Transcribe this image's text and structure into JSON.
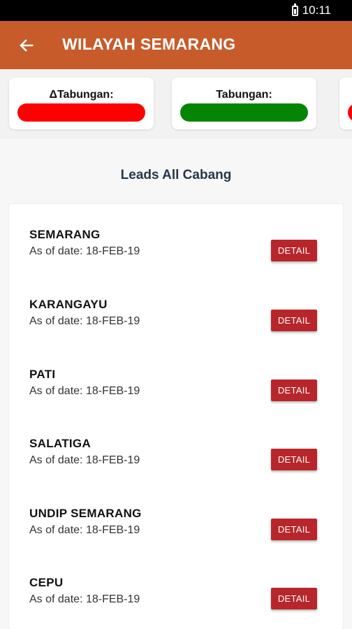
{
  "status_bar": {
    "time": "10:11"
  },
  "header": {
    "title": "WILAYAH SEMARANG"
  },
  "stat_cards": [
    {
      "label": "ΔTabungan:",
      "bar_color": "#ff0000"
    },
    {
      "label": "Tabungan:",
      "bar_color": "#048504"
    },
    {
      "label": "",
      "bar_color": "#ff0000"
    }
  ],
  "section": {
    "title": "Leads All Cabang"
  },
  "branches": [
    {
      "name": "SEMARANG",
      "date": "As of date: 18-FEB-19",
      "button": "DETAIL"
    },
    {
      "name": "KARANGAYU",
      "date": "As of date: 18-FEB-19",
      "button": "DETAIL"
    },
    {
      "name": "PATI",
      "date": "As of date: 18-FEB-19",
      "button": "DETAIL"
    },
    {
      "name": "SALATIGA",
      "date": "As of date: 18-FEB-19",
      "button": "DETAIL"
    },
    {
      "name": "UNDIP SEMARANG",
      "date": "As of date: 18-FEB-19",
      "button": "DETAIL"
    },
    {
      "name": "CEPU",
      "date": "As of date: 18-FEB-19",
      "button": "DETAIL"
    }
  ],
  "colors": {
    "app_bar": "#c75b2a",
    "detail_button": "#b8262b",
    "section_title": "#25384a"
  },
  "icons": {
    "back": "arrow-left-icon",
    "battery": "battery-icon"
  }
}
